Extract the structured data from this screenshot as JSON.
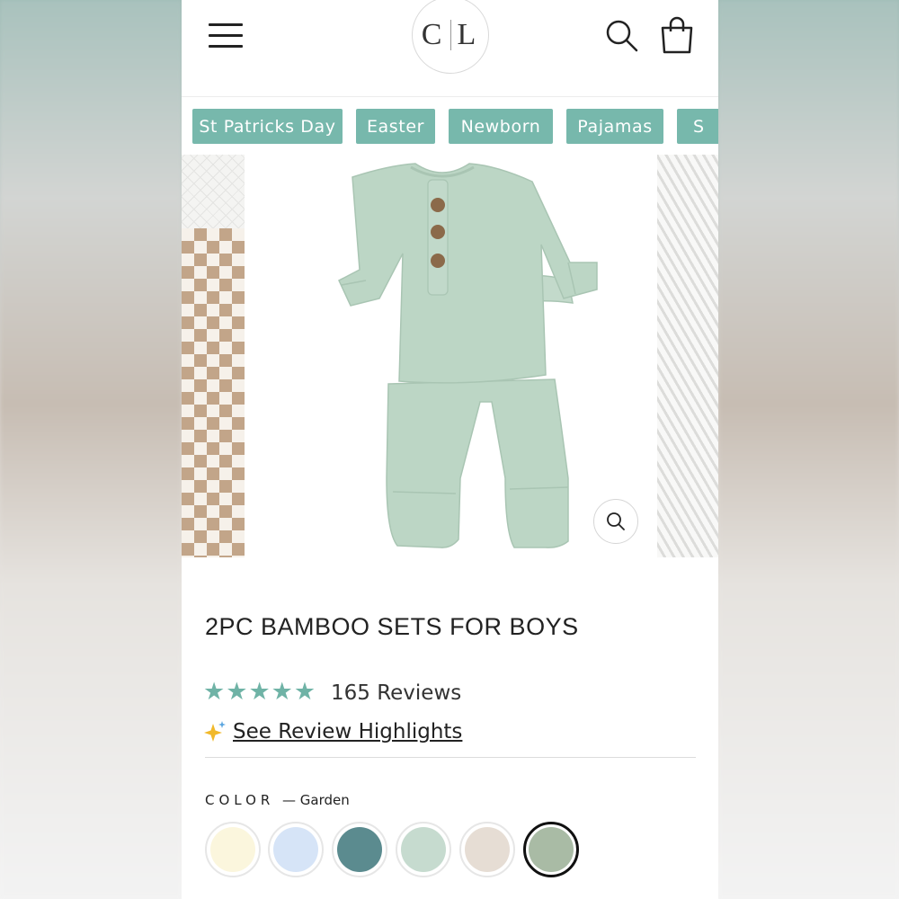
{
  "header": {
    "logo_text": "C L",
    "menu_icon": "hamburger-menu-icon",
    "search_icon": "search-icon",
    "bag_icon": "shopping-bag-icon"
  },
  "categories": [
    {
      "label": "St Patricks Day"
    },
    {
      "label": "Easter"
    },
    {
      "label": "Newborn"
    },
    {
      "label": "Pajamas"
    },
    {
      "label": "S"
    }
  ],
  "gallery": {
    "zoom_icon": "zoom-search-icon"
  },
  "product": {
    "title": "2PC BAMBOO SETS FOR BOYS",
    "rating_stars": 5,
    "reviews_label": "165 Reviews",
    "highlights_label": "See Review Highlights",
    "color_label": "COLOR",
    "color_value": "— Garden"
  },
  "swatches": [
    {
      "color": "#fbf6dd"
    },
    {
      "color": "#d6e4f7"
    },
    {
      "color": "#5b8b8f"
    },
    {
      "color": "#c6dbcf"
    },
    {
      "color": "#e6ddd4"
    },
    {
      "color": "#a9bba5",
      "selected": true
    }
  ],
  "colors": {
    "accent": "#77b8ac",
    "star": "#6fb3a6",
    "garment": "#bcd6c5"
  }
}
